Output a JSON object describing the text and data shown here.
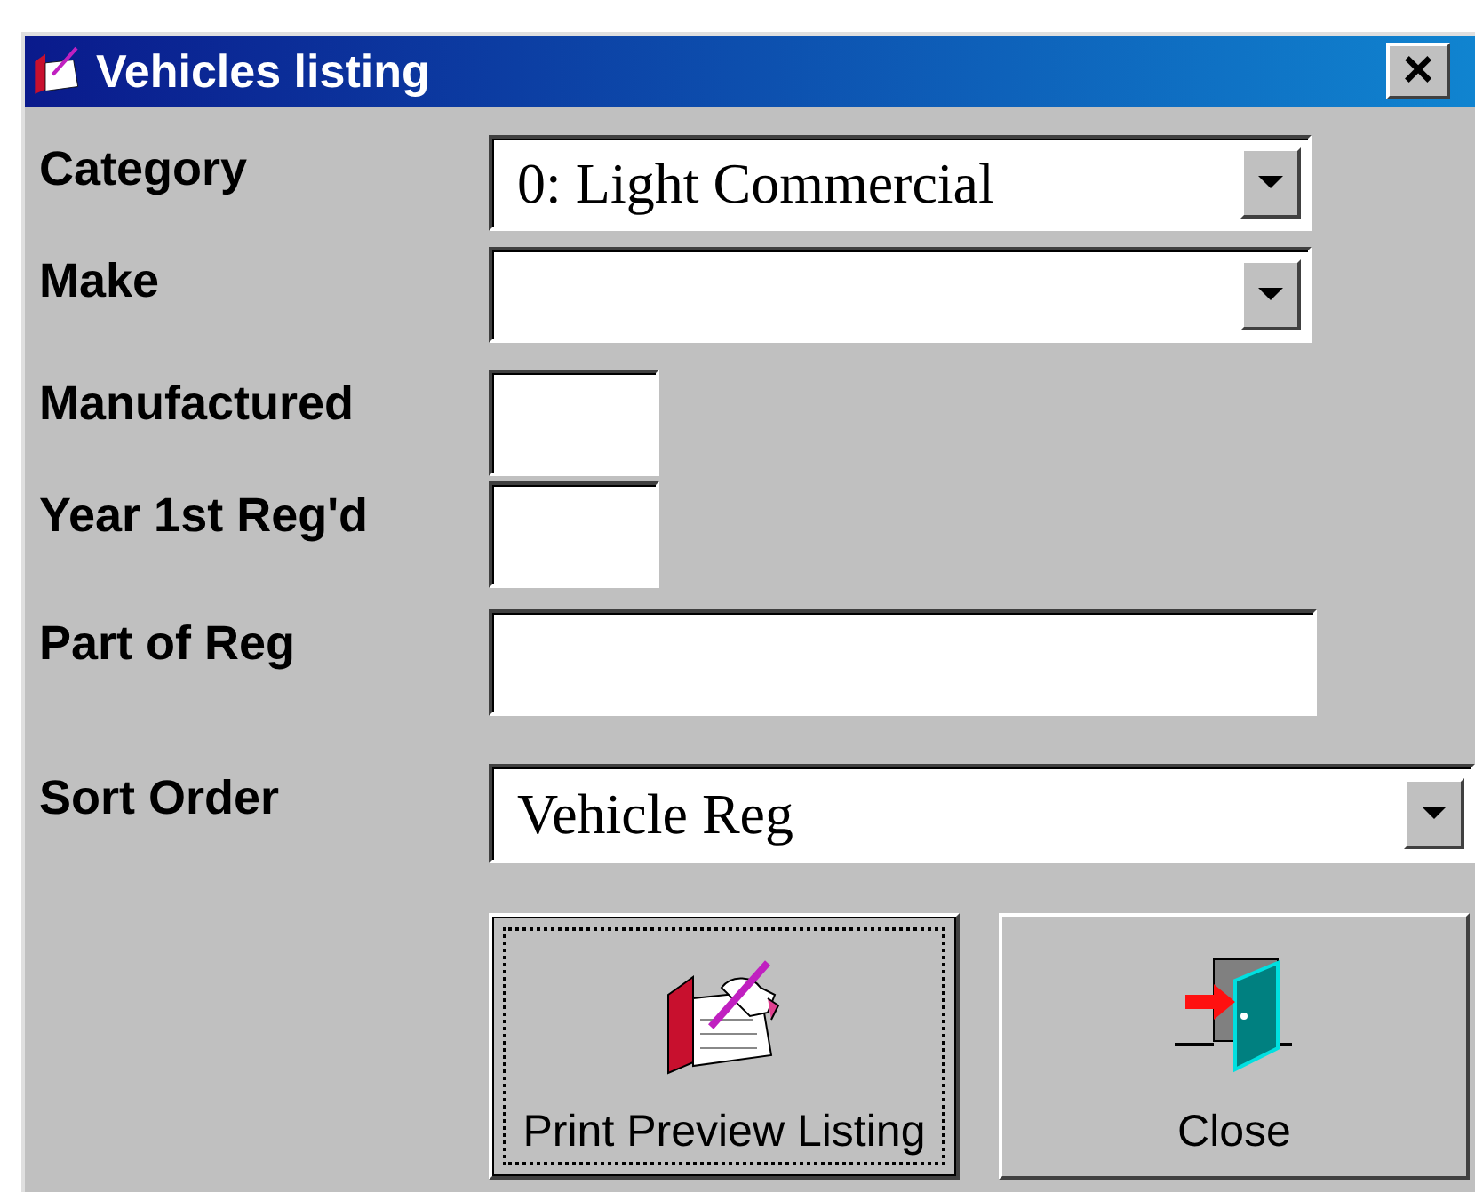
{
  "window": {
    "title": "Vehicles listing",
    "close_label": "×"
  },
  "fields": [
    {
      "kind": "combo",
      "label": "Category",
      "value": "0: Light Commercial"
    },
    {
      "kind": "combo",
      "label": "Make"
    },
    {
      "kind": "short-text",
      "label": "Manufactured"
    },
    {
      "kind": "short-text",
      "label": "Year 1st Reg'd"
    },
    {
      "kind": "text",
      "label": "Part of Reg"
    },
    {
      "kind": "wide-combo",
      "label": "Sort Order",
      "value": "Vehicle Reg"
    }
  ],
  "buttons": [
    {
      "kind": "print-preview",
      "label": "Print Preview Listing",
      "focused": true
    },
    {
      "kind": "close",
      "label": "Close",
      "focused": false
    }
  ]
}
